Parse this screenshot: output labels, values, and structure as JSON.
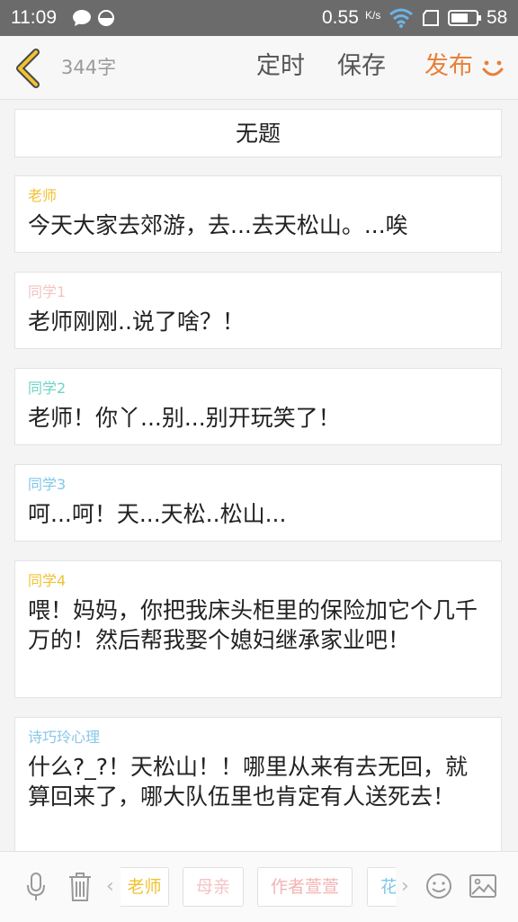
{
  "status_bar": {
    "time": "11:09",
    "speed": "0.55",
    "speed_unit": "K/s",
    "battery": "58"
  },
  "toolbar": {
    "word_count": "344字",
    "schedule": "定时",
    "save": "保存",
    "publish": "发布"
  },
  "colors": {
    "accent_orange": "#e8803a",
    "teacher": "#f1c232",
    "classmate1": "#f4c3c3",
    "classmate2": "#6fd3c7",
    "classmate3": "#7ec8e8",
    "classmate4": "#f1c232",
    "narrator": "#88c7e8"
  },
  "document": {
    "title": "无题",
    "entries": [
      {
        "speaker": "老师",
        "text": "今天大家去郊游，去...去天松山。...唉"
      },
      {
        "speaker": "同学1",
        "text": "老师刚刚..说了啥？！"
      },
      {
        "speaker": "同学2",
        "text": "老师！你丫...别...别开玩笑了！"
      },
      {
        "speaker": "同学3",
        "text": "呵...呵！天...天松..松山..."
      },
      {
        "speaker": "同学4",
        "text": "喂！妈妈，你把我床头柜里的保险加它个几千万的！然后帮我娶个媳妇继承家业吧！"
      },
      {
        "speaker": "诗巧玲心理",
        "text": "什么?_?！天松山！！哪里从来有去无回，就算回来了，哪大队伍里也肯定有人送死去！"
      }
    ]
  },
  "bottom_bar": {
    "icons": [
      "microphone-icon",
      "trash-icon",
      "emoji-icon",
      "image-icon"
    ],
    "roles": [
      "老师",
      "母亲",
      "作者萱萱",
      "花"
    ]
  }
}
